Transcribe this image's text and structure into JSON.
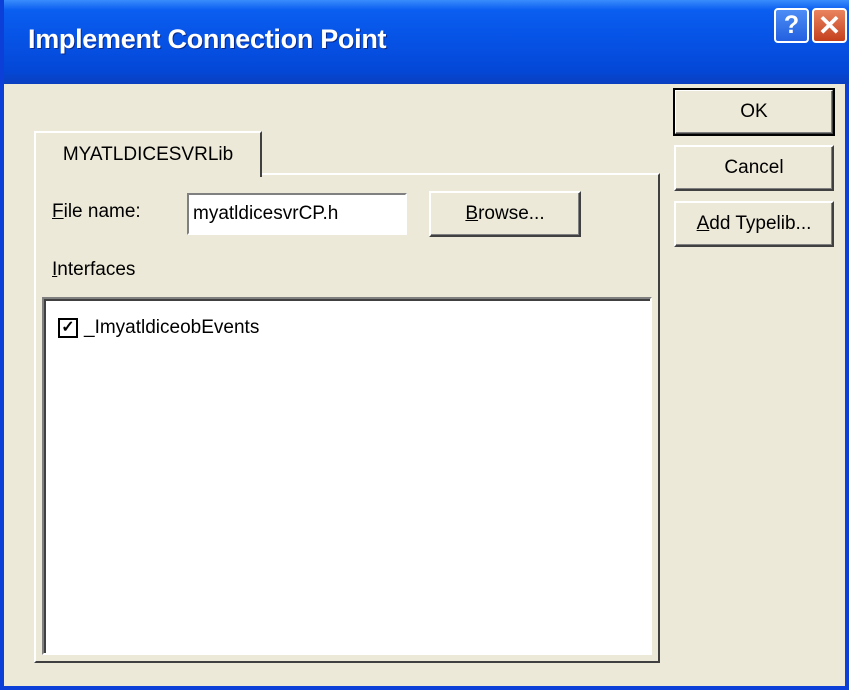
{
  "window": {
    "title": "Implement Connection Point",
    "help_glyph": "?",
    "close_glyph": "✕"
  },
  "buttons": {
    "ok": "OK",
    "cancel": "Cancel",
    "add_typelib_accel": "A",
    "add_typelib_rest": "dd Typelib..."
  },
  "tab": {
    "label": "MYATLDICESVRLib"
  },
  "form": {
    "file_name_accel": "F",
    "file_name_rest": "ile name:",
    "file_name_value": "myatldicesvrCP.h",
    "browse_accel": "B",
    "browse_rest": "rowse...",
    "interfaces_accel": "I",
    "interfaces_rest": "nterfaces"
  },
  "interfaces": {
    "items": [
      {
        "label": "_ImyatldiceobEvents",
        "checked": true,
        "check_glyph": "✓"
      }
    ]
  },
  "colors": {
    "title_blue": "#0652e5",
    "dialog_face": "#ece9d8",
    "close_red": "#c4401c"
  }
}
